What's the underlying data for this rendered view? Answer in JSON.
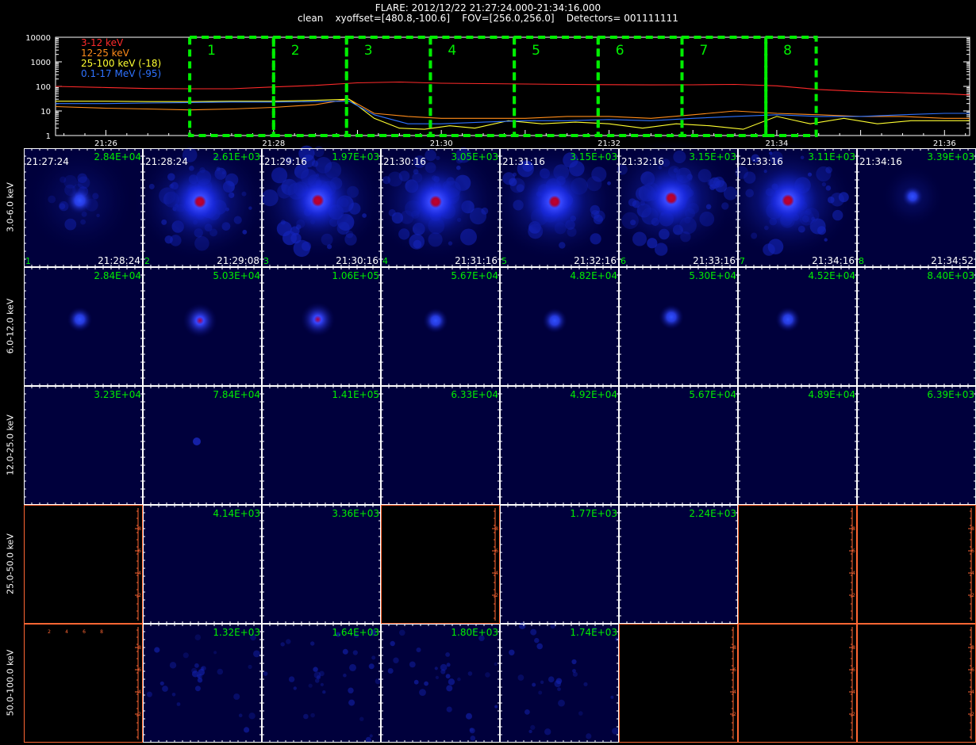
{
  "header": {
    "line1": "FLARE: 2012/12/22 21:27:24.000-21:34:16.000",
    "line2": "clean    xyoffset=[480.8,-100.6]    FOV=[256.0,256.0]    Detectors= 001111111"
  },
  "colors": {
    "red": "#ff2a2a",
    "orange": "#ff8c1a",
    "yellow": "#ffff30",
    "blue": "#2e72ff",
    "green": "#00ee00",
    "axis": "#ff6633"
  },
  "chart_data": [
    {
      "type": "line",
      "title": "",
      "y_scale": "log",
      "ylim": [
        1,
        10000
      ],
      "y_ticks": [
        "10000",
        "1000",
        "100",
        "10",
        "1"
      ],
      "xlim_minutes": [
        -1.6,
        9.3
      ],
      "x_ticks": [
        "21:26",
        "21:28",
        "21:30",
        "21:32",
        "21:34",
        "21:36"
      ],
      "series": [
        {
          "name": "3-12 keV",
          "color": "red",
          "x": [
            -1.6,
            -1,
            -0.5,
            0,
            0.5,
            1,
            1.5,
            2,
            2.5,
            3,
            3.5,
            4,
            4.5,
            5,
            5.5,
            6,
            6.5,
            7,
            7.5,
            8,
            8.5,
            9,
            9.3
          ],
          "y": [
            100,
            90,
            82,
            80,
            80,
            95,
            110,
            140,
            150,
            135,
            130,
            125,
            120,
            118,
            115,
            116,
            120,
            105,
            75,
            62,
            55,
            50,
            45
          ]
        },
        {
          "name": "12-25 keV",
          "color": "orange",
          "x": [
            -1.6,
            -1,
            -0.5,
            0,
            0.5,
            1,
            1.5,
            1.9,
            2.2,
            2.6,
            3,
            3.5,
            4,
            4.5,
            5,
            5.5,
            6,
            6.5,
            7,
            7.5,
            8,
            8.5,
            9,
            9.3
          ],
          "y": [
            15,
            13,
            12,
            11,
            12,
            14,
            18,
            30,
            8,
            6,
            5,
            5,
            5,
            6,
            6,
            5,
            7,
            10,
            8,
            7,
            6,
            6,
            5,
            5
          ]
        },
        {
          "name": "25-100 keV (-18)",
          "color": "yellow",
          "x": [
            -1.6,
            -1,
            -0.5,
            0,
            0.5,
            1,
            1.5,
            1.9,
            2.2,
            2.5,
            2.8,
            3.1,
            3.4,
            3.8,
            4.2,
            4.6,
            5,
            5.4,
            5.8,
            6.2,
            6.6,
            7,
            7.4,
            7.8,
            8.2,
            8.6,
            9,
            9.3
          ],
          "y": [
            25,
            25,
            24,
            24,
            25,
            25,
            27,
            30,
            5,
            2,
            1.8,
            2.5,
            2,
            4,
            3,
            3.5,
            3,
            2,
            3,
            2.5,
            1.8,
            6,
            3,
            5,
            3,
            4,
            4,
            4
          ]
        },
        {
          "name": "0.1-17 MeV (-95)",
          "color": "blue",
          "x": [
            -1.6,
            -1,
            -0.5,
            0,
            0.5,
            1,
            1.5,
            1.9,
            2.2,
            2.6,
            3,
            3.5,
            4,
            4.5,
            5,
            5.5,
            6,
            6.5,
            7,
            7.5,
            8,
            8.5,
            9,
            9.3
          ],
          "y": [
            20,
            20,
            21,
            22,
            23,
            23,
            24,
            25,
            7,
            3,
            3,
            3.5,
            4,
            4,
            4.5,
            4,
            5,
            6,
            7,
            6,
            6,
            7,
            8,
            8
          ]
        }
      ],
      "intervals": [
        {
          "label": "1",
          "start": 0.0,
          "end": 1.0
        },
        {
          "label": "2",
          "start": 1.0,
          "end": 1.87
        },
        {
          "label": "3",
          "start": 1.87,
          "end": 2.87
        },
        {
          "label": "4",
          "start": 2.87,
          "end": 3.87
        },
        {
          "label": "5",
          "start": 3.87,
          "end": 4.87
        },
        {
          "label": "6",
          "start": 4.87,
          "end": 5.87
        },
        {
          "label": "7",
          "start": 5.87,
          "end": 6.87
        },
        {
          "label": "8",
          "start": 6.87,
          "end": 7.47
        }
      ]
    },
    {
      "type": "heatmap",
      "energy_bands": [
        "3.0-6.0 keV",
        "6.0-12.0 keV",
        "12.0-25.0 keV",
        "25.0-50.0 keV",
        "50.0-100.0 keV"
      ],
      "panel_start_times": [
        "21:27:24",
        "21:28:24",
        "21:29:16",
        "21:30:16",
        "21:31:16",
        "21:32:16",
        "21:33:16",
        "21:34:16"
      ],
      "panel_end_times": [
        "21:28:24",
        "21:29:08",
        "21:30:16",
        "21:31:16",
        "21:32:16",
        "21:33:16",
        "21:34:16",
        "21:34:52"
      ],
      "panel_numbers": [
        "1",
        "2",
        "3",
        "4",
        "5",
        "6",
        "7",
        "8"
      ],
      "row_max_labels": [
        [
          "2.84E+04",
          "2.61E+03",
          "1.97E+03",
          "3.05E+03",
          "3.15E+03",
          "3.15E+03",
          "3.11E+03",
          "3.39E+03"
        ],
        [
          "2.84E+04",
          "5.03E+04",
          "1.06E+05",
          "5.67E+04",
          "4.82E+04",
          "5.30E+04",
          "4.52E+04",
          "8.40E+03"
        ],
        [
          "3.23E+04",
          "7.84E+04",
          "1.41E+05",
          "6.33E+04",
          "4.92E+04",
          "5.67E+04",
          "4.89E+04",
          "6.39E+03"
        ],
        [
          "",
          "4.14E+03",
          "3.36E+03",
          "",
          "1.77E+03",
          "2.24E+03",
          "",
          ""
        ],
        [
          "",
          "1.32E+03",
          "1.64E+03",
          "1.80E+03",
          "1.74E+03",
          "",
          "",
          ""
        ]
      ],
      "panel_kind": [
        [
          "source",
          "diffuse",
          "diffuse",
          "diffuse",
          "diffuse",
          "diffuse",
          "diffuse",
          "faint"
        ],
        [
          "small",
          "small",
          "small",
          "small",
          "small",
          "small",
          "small",
          "none"
        ],
        [
          "none",
          "tiny",
          "none",
          "none",
          "none",
          "none",
          "none",
          "none"
        ],
        [
          "empty",
          "none",
          "none",
          "empty",
          "none",
          "none",
          "empty",
          "empty"
        ],
        [
          "empty",
          "noise",
          "noise",
          "noise",
          "noise",
          "empty",
          "empty",
          "empty"
        ]
      ],
      "source_x": [
        0.47,
        0.48,
        0.47,
        0.46,
        0.46,
        0.44,
        0.42,
        0.42
      ],
      "source_y": [
        0.44,
        0.45,
        0.44,
        0.45,
        0.45,
        0.42,
        0.44,
        0.44
      ],
      "empty_axis_ticks": [
        "2",
        "4",
        "6",
        "8"
      ]
    }
  ]
}
